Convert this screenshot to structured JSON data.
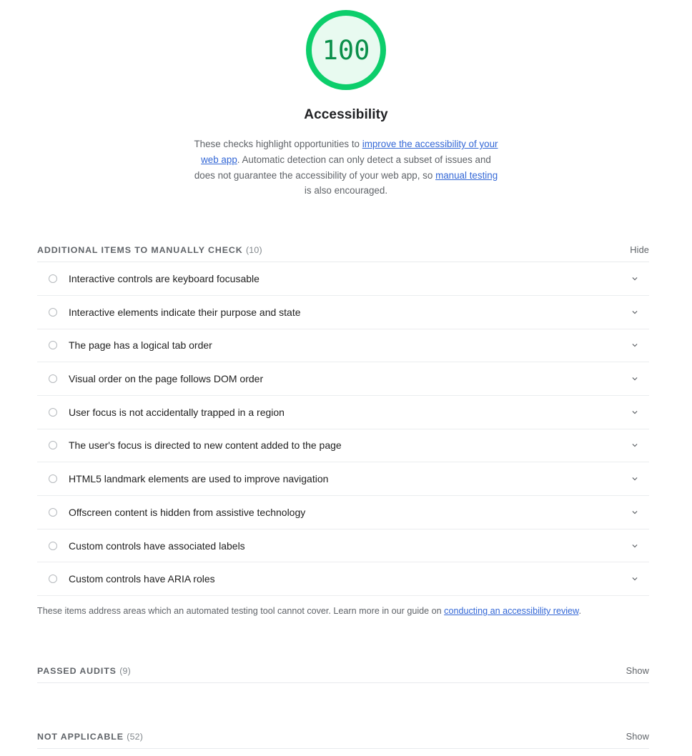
{
  "score": {
    "value": "100",
    "title": "Accessibility",
    "ring_color": "#0cce6b",
    "fill_color": "#e8faf0",
    "value_color": "#0a8f4a"
  },
  "description": {
    "part1": "These checks highlight opportunities to ",
    "link1": "improve the accessibility of your web app",
    "part2": ". Automatic detection can only detect a subset of issues and does not guarantee the accessibility of your web app, so ",
    "link2": "manual testing",
    "part3": " is also encouraged."
  },
  "manual_section": {
    "title": "ADDITIONAL ITEMS TO MANUALLY CHECK",
    "count": "(10)",
    "toggle_label": "Hide",
    "items": [
      {
        "label": "Interactive controls are keyboard focusable",
        "marker": "circle-outline-icon",
        "chevron": "chevron-down-icon"
      },
      {
        "label": "Interactive elements indicate their purpose and state",
        "marker": "circle-outline-icon",
        "chevron": "chevron-down-icon"
      },
      {
        "label": "The page has a logical tab order",
        "marker": "circle-outline-icon",
        "chevron": "chevron-down-icon"
      },
      {
        "label": "Visual order on the page follows DOM order",
        "marker": "circle-outline-icon",
        "chevron": "chevron-down-icon"
      },
      {
        "label": "User focus is not accidentally trapped in a region",
        "marker": "circle-outline-icon",
        "chevron": "chevron-down-icon"
      },
      {
        "label": "The user's focus is directed to new content added to the page",
        "marker": "circle-outline-icon",
        "chevron": "chevron-down-icon"
      },
      {
        "label": "HTML5 landmark elements are used to improve navigation",
        "marker": "circle-outline-icon",
        "chevron": "chevron-down-icon"
      },
      {
        "label": "Offscreen content is hidden from assistive technology",
        "marker": "circle-outline-icon",
        "chevron": "chevron-down-icon"
      },
      {
        "label": "Custom controls have associated labels",
        "marker": "circle-outline-icon",
        "chevron": "chevron-down-icon"
      },
      {
        "label": "Custom controls have ARIA roles",
        "marker": "circle-outline-icon",
        "chevron": "chevron-down-icon"
      }
    ],
    "note_part1": "These items address areas which an automated testing tool cannot cover. Learn more in our guide on ",
    "note_link": "conducting an accessibility review",
    "note_part2": "."
  },
  "passed_section": {
    "title": "PASSED AUDITS",
    "count": "(9)",
    "toggle_label": "Show"
  },
  "not_applicable_section": {
    "title": "NOT APPLICABLE",
    "count": "(52)",
    "toggle_label": "Show"
  },
  "colors": {
    "link": "#3367d6",
    "text_secondary": "#5f6368",
    "divider": "#ebedef"
  }
}
